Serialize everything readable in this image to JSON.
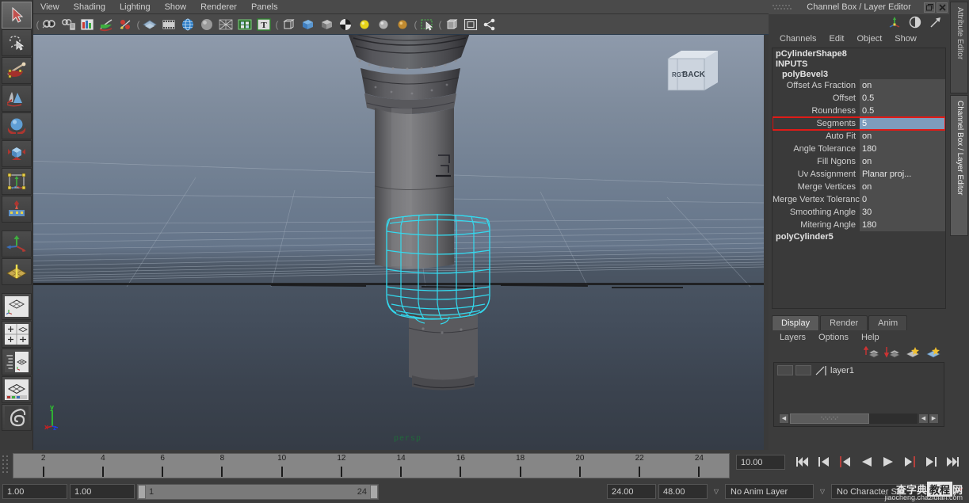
{
  "app": {
    "viewport_label": "persp"
  },
  "menubar": {
    "items": [
      "View",
      "Shading",
      "Lighting",
      "Show",
      "Renderer",
      "Panels"
    ]
  },
  "shelf": {
    "icons": [
      {
        "name": "select-camera-icon",
        "kind": "cam"
      },
      {
        "name": "camera-attributes-icon",
        "kind": "camlist"
      },
      {
        "name": "image-plane-icon",
        "kind": "chart"
      },
      {
        "name": "paint-effects-icon",
        "kind": "paint"
      },
      {
        "name": "light-manip-icon",
        "kind": "lightman"
      },
      {
        "name": "xray-shading-icon",
        "kind": "xray"
      },
      {
        "name": "film-gate-icon",
        "kind": "film"
      },
      {
        "name": "globe-icon",
        "kind": "globe"
      },
      {
        "name": "sphere-gray-icon",
        "kind": "sphere"
      },
      {
        "name": "wireframe-on-shaded-icon",
        "kind": "wire"
      },
      {
        "name": "texture-icon",
        "kind": "tex"
      },
      {
        "name": "text-toggle-icon",
        "kind": "text"
      },
      {
        "name": "wireframe-cube-icon",
        "kind": "cubewire"
      },
      {
        "name": "smooth-shade-cube-icon",
        "kind": "cubeblue"
      },
      {
        "name": "shaded-cube-icon",
        "kind": "cubeshade"
      },
      {
        "name": "checker-icon",
        "kind": "checker"
      },
      {
        "name": "light-yellow-icon",
        "kind": "ballY"
      },
      {
        "name": "light-gray-icon",
        "kind": "ballG"
      },
      {
        "name": "light-orange-icon",
        "kind": "ballO"
      },
      {
        "name": "marquee-select-icon",
        "kind": "marquee"
      },
      {
        "name": "isolate-select-icon",
        "kind": "cubewire2"
      },
      {
        "name": "panel-layout-icon",
        "kind": "panel"
      },
      {
        "name": "share-graph-icon",
        "kind": "share"
      }
    ]
  },
  "toolbox": {
    "tools": [
      {
        "name": "select-tool",
        "label": "Select Tool",
        "selected": true
      },
      {
        "name": "lasso-select-tool",
        "label": "Lasso Select Tool",
        "selected": false
      },
      {
        "name": "paint-select-tool",
        "label": "Paint Select Tool",
        "selected": false
      },
      {
        "name": "move-tool",
        "label": "Move Tool",
        "selected": false
      },
      {
        "name": "rotate-tool",
        "label": "Rotate Tool",
        "selected": false
      },
      {
        "name": "scale-tool",
        "label": "Scale Tool",
        "selected": false
      },
      {
        "name": "universal-manipulator-tool",
        "label": "Universal Manipulator",
        "selected": false
      },
      {
        "name": "soft-modification-tool",
        "label": "Soft Modification Tool",
        "selected": false
      },
      {
        "name": "show-manipulator-tool",
        "label": "Show Manipulator Tool",
        "selected": false
      },
      {
        "name": "last-tool-used",
        "label": "Last Tool Used",
        "selected": false
      },
      {
        "name": "single-perspective-view",
        "label": "Single Perspective View",
        "selected": false
      },
      {
        "name": "four-view-layout",
        "label": "Four View Layout",
        "selected": false
      },
      {
        "name": "outliner-persp-layout",
        "label": "Outliner / Persp Layout",
        "selected": false
      },
      {
        "name": "hypershade-persp-layout",
        "label": "Hypershade / Persp Layout",
        "selected": false
      },
      {
        "name": "paint-effects-canvas",
        "label": "Paint Effects Canvas",
        "selected": false
      }
    ]
  },
  "channel_box": {
    "window_title": "Channel Box / Layer Editor",
    "title_buttons": [
      "undock",
      "close"
    ],
    "menu": [
      "Channels",
      "Edit",
      "Object",
      "Show"
    ],
    "object_name": "pCylinderShape8",
    "inputs_label": "INPUTS",
    "node_name": "polyBevel3",
    "attributes": [
      {
        "label": "Offset As Fraction",
        "value": "on",
        "selected": false
      },
      {
        "label": "Offset",
        "value": "0.5",
        "selected": false
      },
      {
        "label": "Roundness",
        "value": "0.5",
        "selected": false
      },
      {
        "label": "Segments",
        "value": "5",
        "selected": true
      },
      {
        "label": "Auto Fit",
        "value": "on",
        "selected": false
      },
      {
        "label": "Angle Tolerance",
        "value": "180",
        "selected": false
      },
      {
        "label": "Fill Ngons",
        "value": "on",
        "selected": false
      },
      {
        "label": "Uv Assignment",
        "value": "Planar proj...",
        "selected": false
      },
      {
        "label": "Merge Vertices",
        "value": "on",
        "selected": false
      },
      {
        "label": "Merge Vertex Tolerance",
        "value": "0",
        "selected": false
      },
      {
        "label": "Smoothing Angle",
        "value": "30",
        "selected": false
      },
      {
        "label": "Mitering Angle",
        "value": "180",
        "selected": false
      }
    ],
    "second_node": "polyCylinder5",
    "highlight_color": "#ee1f16",
    "selected_row_color": "#7e9cbc"
  },
  "layer_editor": {
    "tabs": [
      {
        "label": "Display",
        "active": true
      },
      {
        "label": "Render",
        "active": false
      },
      {
        "label": "Anim",
        "active": false
      }
    ],
    "menu": [
      "Layers",
      "Options",
      "Help"
    ],
    "icons": [
      {
        "name": "move-layer-up-icon"
      },
      {
        "name": "move-layer-down-icon"
      },
      {
        "name": "new-layer-icon"
      },
      {
        "name": "new-layer-from-selected-icon"
      }
    ],
    "layers": [
      {
        "name": "layer1",
        "visible": "",
        "playback": ""
      }
    ]
  },
  "side_tabs": [
    {
      "label": "Attribute Editor",
      "active": false
    },
    {
      "label": "Channel Box / Layer Editor",
      "active": true
    }
  ],
  "time_slider": {
    "ticks": [
      {
        "label": "2",
        "value": 2
      },
      {
        "label": "4",
        "value": 4
      },
      {
        "label": "6",
        "value": 6
      },
      {
        "label": "8",
        "value": 8
      },
      {
        "label": "10",
        "value": 10
      },
      {
        "label": "12",
        "value": 12
      },
      {
        "label": "14",
        "value": 14
      },
      {
        "label": "16",
        "value": 16
      },
      {
        "label": "18",
        "value": 18
      },
      {
        "label": "20",
        "value": 20
      },
      {
        "label": "22",
        "value": 22
      },
      {
        "label": "24",
        "value": 24
      }
    ],
    "range_min": 1,
    "range_max": 25,
    "current_frame_field": "10.00",
    "playback_buttons": [
      {
        "name": "go-to-start-button"
      },
      {
        "name": "step-back-keyframe-button"
      },
      {
        "name": "step-back-frame-button"
      },
      {
        "name": "play-backwards-button"
      },
      {
        "name": "play-forwards-button"
      },
      {
        "name": "step-forward-frame-button"
      },
      {
        "name": "step-forward-keyframe-button"
      },
      {
        "name": "go-to-end-button"
      }
    ]
  },
  "range_bar": {
    "anim_start": "1.00",
    "anim_end": "1.00",
    "range_start_label": "1",
    "range_end_label": "24",
    "playback_start": "24.00",
    "playback_end": "48.00",
    "anim_layer": "No Anim Layer",
    "character_set": "No Character Set"
  },
  "viewcube": {
    "front_face": "BACK",
    "side_face": "RGT"
  },
  "axis_gizmo": {
    "x_label": "x",
    "y_label": "y",
    "z_label": "z"
  },
  "watermark": {
    "brand": "查字典",
    "brand_box": "教程",
    "brand_tail": "网",
    "url": "jiaocheng.chazidian.com"
  }
}
